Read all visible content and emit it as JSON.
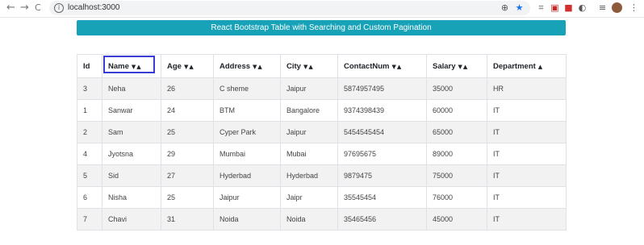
{
  "browser": {
    "url": "localhost:3000",
    "back_glyph": "←",
    "forward_glyph": "→",
    "reload_glyph": "C",
    "info_glyph": "i"
  },
  "header": {
    "title": "React Bootstrap Table with Searching and Custom Pagination"
  },
  "table": {
    "columns": [
      {
        "label": "Id",
        "sort_desc": "",
        "sort_asc": ""
      },
      {
        "label": "Name",
        "sort_desc": "▼",
        "sort_asc": "▲"
      },
      {
        "label": "Age",
        "sort_desc": "▼",
        "sort_asc": "▲"
      },
      {
        "label": "Address",
        "sort_desc": "▼",
        "sort_asc": "▲"
      },
      {
        "label": "City",
        "sort_desc": "▼",
        "sort_asc": "▲"
      },
      {
        "label": "ContactNum",
        "sort_desc": "▼",
        "sort_asc": "▲"
      },
      {
        "label": "Salary",
        "sort_desc": "▼",
        "sort_asc": "▲"
      },
      {
        "label": "Department",
        "sort_desc": "",
        "sort_asc": "▲"
      }
    ],
    "rows": [
      [
        "3",
        "Neha",
        "26",
        "C sheme",
        "Jaipur",
        "5874957495",
        "35000",
        "HR"
      ],
      [
        "1",
        "Sanwar",
        "24",
        "BTM",
        "Bangalore",
        "9374398439",
        "60000",
        "IT"
      ],
      [
        "2",
        "Sam",
        "25",
        "Cyper Park",
        "Jaipur",
        "5454545454",
        "65000",
        "IT"
      ],
      [
        "4",
        "Jyotsna",
        "29",
        "Mumbai",
        "Mubai",
        "97695675",
        "89000",
        "IT"
      ],
      [
        "5",
        "Sid",
        "27",
        "Hyderbad",
        "Hyderbad",
        "9879475",
        "75000",
        "IT"
      ],
      [
        "6",
        "Nisha",
        "25",
        "Jaipur",
        "Jaipr",
        "35545454",
        "76000",
        "IT"
      ],
      [
        "7",
        "Chavi",
        "31",
        "Noida",
        "Noida",
        "35465456",
        "45000",
        "IT"
      ]
    ]
  },
  "colors": {
    "title_bar": "#17a2b8",
    "highlight_box": "#3b3bd6",
    "striped_row": "#f2f2f2"
  },
  "icons": [
    "back-arrow-icon",
    "forward-arrow-icon",
    "reload-icon",
    "info-icon",
    "zoom-icon",
    "star-icon",
    "extension-icons",
    "menu-icon",
    "avatar"
  ]
}
